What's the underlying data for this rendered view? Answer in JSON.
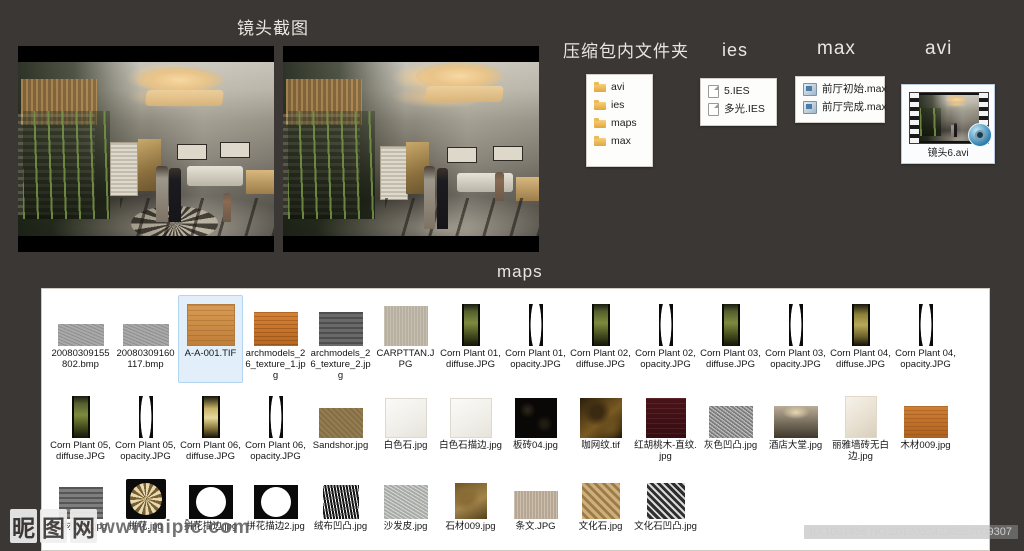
{
  "headings": {
    "shots": "镜头截图",
    "zip_folder": "压缩包内文件夹",
    "ies": "ies",
    "max": "max",
    "avi": "avi",
    "maps": "maps"
  },
  "zip_panel": {
    "items": [
      "avi",
      "ies",
      "maps",
      "max"
    ]
  },
  "ies_panel": {
    "items": [
      "5.IES",
      "多光.IES"
    ]
  },
  "max_panel": {
    "items": [
      "前厅初始.max",
      "前厅完成.max"
    ]
  },
  "avi_panel": {
    "caption": "镜头6.avi"
  },
  "maps_grid": {
    "items": [
      {
        "label": "20080309155802.bmp",
        "tn": "t-bmp",
        "selected": false
      },
      {
        "label": "20080309160117.bmp",
        "tn": "t-bmp",
        "selected": false
      },
      {
        "label": "A-A-001.TIF",
        "tn": "t-wood-l",
        "selected": true
      },
      {
        "label": "archmodels_26_texture_1.jpg",
        "tn": "t-wood-o",
        "selected": false
      },
      {
        "label": "archmodels_26_texture_2.jpg",
        "tn": "t-gray",
        "selected": false
      },
      {
        "label": "CARPTTAN.JPG",
        "tn": "t-carpet",
        "selected": false
      },
      {
        "label": "Corn Plant 01,diffuse.JPG",
        "tn": "t-corn-d",
        "selected": false
      },
      {
        "label": "Corn Plant 01,opacity.JPG",
        "tn": "t-corn-o",
        "selected": false
      },
      {
        "label": "Corn Plant 02,diffuse.JPG",
        "tn": "t-corn-d",
        "selected": false
      },
      {
        "label": "Corn Plant 02,opacity.JPG",
        "tn": "t-corn-o",
        "selected": false
      },
      {
        "label": "Corn Plant 03,diffuse.JPG",
        "tn": "t-corn-d",
        "selected": false
      },
      {
        "label": "Corn Plant 03,opacity.JPG",
        "tn": "t-corn-o",
        "selected": false
      },
      {
        "label": "Corn Plant 04,diffuse.JPG",
        "tn": "t-corn-d4",
        "selected": false
      },
      {
        "label": "Corn Plant 04,opacity.JPG",
        "tn": "t-corn-o",
        "selected": false
      },
      {
        "label": "Corn Plant 05,diffuse.JPG",
        "tn": "t-corn-d",
        "selected": false
      },
      {
        "label": "Corn Plant 05,opacity.JPG",
        "tn": "t-corn-o",
        "selected": false
      },
      {
        "label": "Corn Plant 06,diffuse.JPG",
        "tn": "t-corn-d6",
        "selected": false
      },
      {
        "label": "Corn Plant 06,opacity.JPG",
        "tn": "t-corn-o",
        "selected": false
      },
      {
        "label": "Sandshor.jpg",
        "tn": "t-sand",
        "selected": false
      },
      {
        "label": "白色石.jpg",
        "tn": "t-white-stone",
        "selected": false
      },
      {
        "label": "白色石描边.jpg",
        "tn": "t-white-stone",
        "selected": false
      },
      {
        "label": "板砖04.jpg",
        "tn": "t-black",
        "selected": false
      },
      {
        "label": "咖网纹.tif",
        "tn": "t-coffee",
        "selected": false
      },
      {
        "label": "红胡桃木-直纹.jpg",
        "tn": "t-walnut",
        "selected": false
      },
      {
        "label": "灰色凹凸.jpg",
        "tn": "t-grayb",
        "selected": false
      },
      {
        "label": "酒店大堂.jpg",
        "tn": "t-lobby",
        "selected": false
      },
      {
        "label": "丽雅墙砖无白边.jpg",
        "tn": "t-wall-tile",
        "selected": false
      },
      {
        "label": "木材009.jpg",
        "tn": "t-wood009",
        "selected": false
      },
      {
        "label": "木材凹凸.jpg",
        "tn": "t-woodbump",
        "selected": false
      },
      {
        "label": "拼花.jpg",
        "tn": "t-medal",
        "selected": false
      },
      {
        "label": "拼花描边.jpg",
        "tn": "t-circ",
        "selected": false
      },
      {
        "label": "拼花描边2.jpg",
        "tn": "t-circ",
        "selected": false
      },
      {
        "label": "绒布凹凸.jpg",
        "tn": "t-fur",
        "selected": false
      },
      {
        "label": "沙发皮.jpg",
        "tn": "t-leather",
        "selected": false
      },
      {
        "label": "石材009.jpg",
        "tn": "t-stone009",
        "selected": false
      },
      {
        "label": "条文.JPG",
        "tn": "t-stripe",
        "selected": false
      },
      {
        "label": "文化石.jpg",
        "tn": "t-culture",
        "selected": false
      },
      {
        "label": "文化石凹凸.jpg",
        "tn": "t-culture-b",
        "selected": false
      }
    ]
  },
  "watermark": {
    "mark_1": "昵",
    "mark_2": "图",
    "mark_3": "网",
    "url": "www.nipic.com",
    "id_text": "ID:1091456 NO:20120524230557009307"
  },
  "colors": {
    "background": "#3b3734",
    "panel": "#ffffff",
    "selection": "#e2effa",
    "heading_text": "#e9e6e2"
  }
}
